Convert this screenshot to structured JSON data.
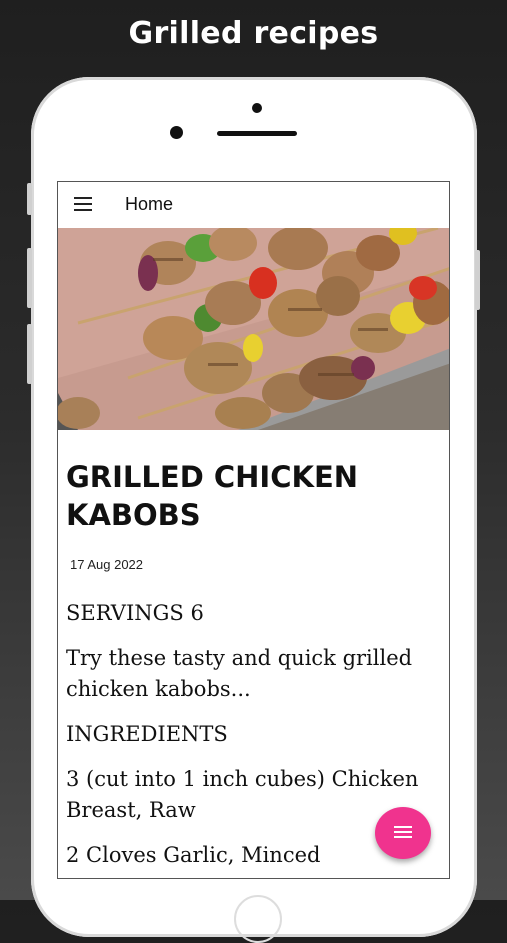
{
  "promo": {
    "title": "Grilled recipes"
  },
  "appbar": {
    "title": "Home",
    "menu_icon": "hamburger-menu-icon"
  },
  "recipe": {
    "image_alt": "grilled chicken kabobs on a baking tray",
    "title": "GRILLED CHICKEN KABOBS",
    "date": "17 Aug 2022",
    "servings": "SERVINGS 6",
    "description": "Try these tasty and quick grilled chicken kabobs...",
    "ingredients_heading": "INGREDIENTS",
    "ingredients": [
      "3 (cut into 1 inch cubes) Chicken Breast, Raw",
      "2 Cloves Garlic, Minced"
    ]
  },
  "fab": {
    "icon": "list-menu-icon",
    "color": "#f0338e"
  }
}
